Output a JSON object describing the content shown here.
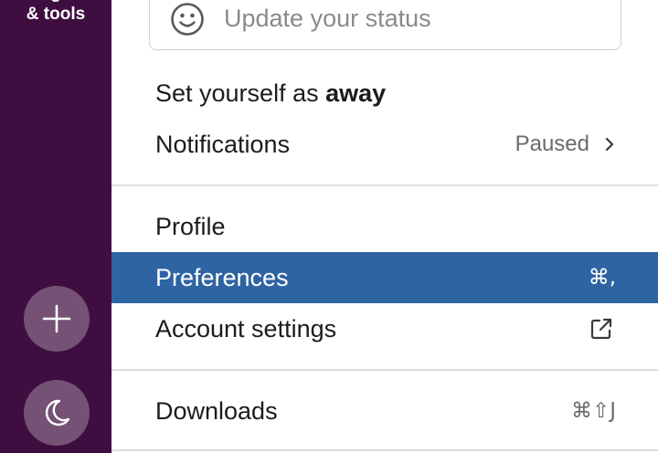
{
  "sidebar": {
    "cut_label": "g",
    "tools_label": "& tools",
    "add_button_icon": "plus-icon",
    "theme_button_icon": "moon-icon",
    "background": "#3f0e40"
  },
  "status": {
    "icon": "smiley-icon",
    "placeholder": "Update your status"
  },
  "menu": {
    "away": {
      "prefix": "Set yourself as ",
      "bold": "away"
    },
    "notifications": {
      "label": "Notifications",
      "value": "Paused",
      "icon": "chevron-right-icon"
    },
    "profile": {
      "label": "Profile"
    },
    "preferences": {
      "label": "Preferences",
      "shortcut": "⌘,",
      "highlight": "#2f64a2"
    },
    "account": {
      "label": "Account settings",
      "icon": "external-link-icon"
    },
    "downloads": {
      "label": "Downloads",
      "shortcut": "⌘⇧J"
    }
  }
}
